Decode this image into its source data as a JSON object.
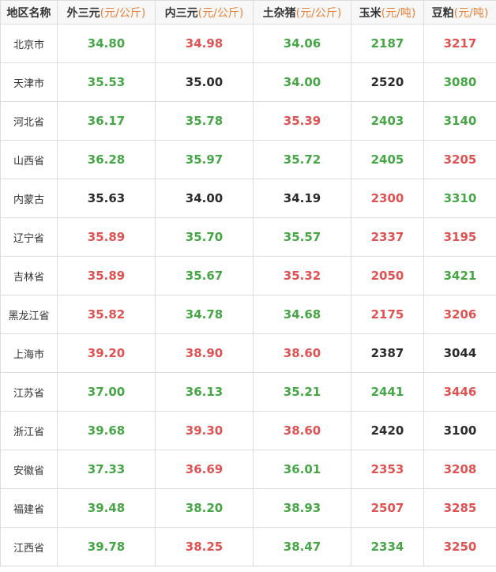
{
  "colors": {
    "up": "#e05252",
    "down": "#46a646",
    "flat": "#2b2b2b",
    "unit": "#e8823a"
  },
  "headers": [
    {
      "name": "地区名称",
      "unit": ""
    },
    {
      "name": "外三元",
      "unit": "(元/公斤)"
    },
    {
      "name": "内三元",
      "unit": "(元/公斤)"
    },
    {
      "name": "土杂猪",
      "unit": "(元/公斤)"
    },
    {
      "name": "玉米",
      "unit": "(元/吨)"
    },
    {
      "name": "豆粕",
      "unit": "(元/吨)"
    }
  ],
  "rows": [
    {
      "region": "北京市",
      "cells": [
        {
          "value": "34.80",
          "trend": "down"
        },
        {
          "value": "34.98",
          "trend": "up"
        },
        {
          "value": "34.06",
          "trend": "down"
        },
        {
          "value": "2187",
          "trend": "down"
        },
        {
          "value": "3217",
          "trend": "up"
        }
      ]
    },
    {
      "region": "天津市",
      "cells": [
        {
          "value": "35.53",
          "trend": "down"
        },
        {
          "value": "35.00",
          "trend": "flat"
        },
        {
          "value": "34.00",
          "trend": "down"
        },
        {
          "value": "2520",
          "trend": "flat"
        },
        {
          "value": "3080",
          "trend": "down"
        }
      ]
    },
    {
      "region": "河北省",
      "cells": [
        {
          "value": "36.17",
          "trend": "down"
        },
        {
          "value": "35.78",
          "trend": "down"
        },
        {
          "value": "35.39",
          "trend": "up"
        },
        {
          "value": "2403",
          "trend": "down"
        },
        {
          "value": "3140",
          "trend": "down"
        }
      ]
    },
    {
      "region": "山西省",
      "cells": [
        {
          "value": "36.28",
          "trend": "down"
        },
        {
          "value": "35.97",
          "trend": "down"
        },
        {
          "value": "35.72",
          "trend": "down"
        },
        {
          "value": "2405",
          "trend": "down"
        },
        {
          "value": "3205",
          "trend": "up"
        }
      ]
    },
    {
      "region": "内蒙古",
      "cells": [
        {
          "value": "35.63",
          "trend": "flat"
        },
        {
          "value": "34.00",
          "trend": "flat"
        },
        {
          "value": "34.19",
          "trend": "flat"
        },
        {
          "value": "2300",
          "trend": "up"
        },
        {
          "value": "3310",
          "trend": "down"
        }
      ]
    },
    {
      "region": "辽宁省",
      "cells": [
        {
          "value": "35.89",
          "trend": "up"
        },
        {
          "value": "35.70",
          "trend": "down"
        },
        {
          "value": "35.57",
          "trend": "down"
        },
        {
          "value": "2337",
          "trend": "up"
        },
        {
          "value": "3195",
          "trend": "up"
        }
      ]
    },
    {
      "region": "吉林省",
      "cells": [
        {
          "value": "35.89",
          "trend": "up"
        },
        {
          "value": "35.67",
          "trend": "down"
        },
        {
          "value": "35.32",
          "trend": "up"
        },
        {
          "value": "2050",
          "trend": "up"
        },
        {
          "value": "3421",
          "trend": "down"
        }
      ]
    },
    {
      "region": "黑龙江省",
      "cells": [
        {
          "value": "35.82",
          "trend": "up"
        },
        {
          "value": "34.78",
          "trend": "down"
        },
        {
          "value": "34.68",
          "trend": "down"
        },
        {
          "value": "2175",
          "trend": "up"
        },
        {
          "value": "3206",
          "trend": "up"
        }
      ]
    },
    {
      "region": "上海市",
      "cells": [
        {
          "value": "39.20",
          "trend": "up"
        },
        {
          "value": "38.90",
          "trend": "up"
        },
        {
          "value": "38.60",
          "trend": "up"
        },
        {
          "value": "2387",
          "trend": "flat"
        },
        {
          "value": "3044",
          "trend": "flat"
        }
      ]
    },
    {
      "region": "江苏省",
      "cells": [
        {
          "value": "37.00",
          "trend": "down"
        },
        {
          "value": "36.13",
          "trend": "down"
        },
        {
          "value": "35.21",
          "trend": "down"
        },
        {
          "value": "2441",
          "trend": "down"
        },
        {
          "value": "3446",
          "trend": "up"
        }
      ]
    },
    {
      "region": "浙江省",
      "cells": [
        {
          "value": "39.68",
          "trend": "down"
        },
        {
          "value": "39.30",
          "trend": "up"
        },
        {
          "value": "38.60",
          "trend": "up"
        },
        {
          "value": "2420",
          "trend": "flat"
        },
        {
          "value": "3100",
          "trend": "flat"
        }
      ]
    },
    {
      "region": "安徽省",
      "cells": [
        {
          "value": "37.33",
          "trend": "down"
        },
        {
          "value": "36.69",
          "trend": "up"
        },
        {
          "value": "36.01",
          "trend": "down"
        },
        {
          "value": "2353",
          "trend": "up"
        },
        {
          "value": "3208",
          "trend": "up"
        }
      ]
    },
    {
      "region": "福建省",
      "cells": [
        {
          "value": "39.48",
          "trend": "down"
        },
        {
          "value": "38.20",
          "trend": "down"
        },
        {
          "value": "38.93",
          "trend": "down"
        },
        {
          "value": "2507",
          "trend": "up"
        },
        {
          "value": "3285",
          "trend": "up"
        }
      ]
    },
    {
      "region": "江西省",
      "cells": [
        {
          "value": "39.78",
          "trend": "down"
        },
        {
          "value": "38.25",
          "trend": "up"
        },
        {
          "value": "38.47",
          "trend": "down"
        },
        {
          "value": "2334",
          "trend": "down"
        },
        {
          "value": "3250",
          "trend": "up"
        }
      ]
    }
  ]
}
